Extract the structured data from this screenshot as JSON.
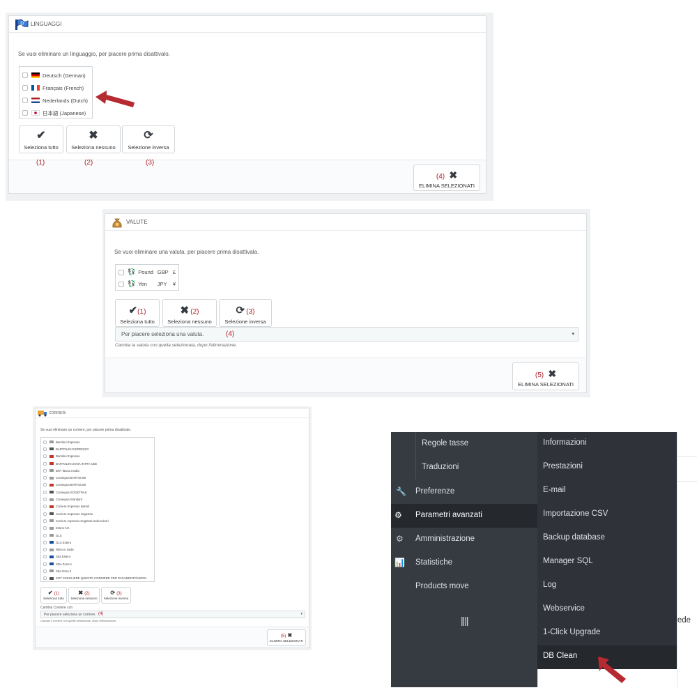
{
  "languages": {
    "title": "LINGUAGGI",
    "intro": "Se vuoi eliminare un linguaggio, per piacere prima disattivalo.",
    "items": [
      {
        "label": "Deutsch (German)",
        "flag": "de"
      },
      {
        "label": "Français (French)",
        "flag": "fr"
      },
      {
        "label": "Nederlands (Dutch)",
        "flag": "nl"
      },
      {
        "label": "日本語 (Japanese)",
        "flag": "jp"
      }
    ],
    "buttons": [
      {
        "label": "Seleziona tutto",
        "icon": "check-icon",
        "num": "(1)"
      },
      {
        "label": "Seleziona nessuno",
        "icon": "cross-icon",
        "num": "(2)"
      },
      {
        "label": "Selezione inversa",
        "icon": "refresh-icon",
        "num": "(3)"
      }
    ],
    "delete": {
      "label": "ELIMINA SELEZIONATI",
      "num": "(4)"
    }
  },
  "currencies": {
    "title": "VALUTE",
    "intro": "Se vuoi eliminare una valuta, per piacere prima disattivala.",
    "items": [
      {
        "name": "Pound",
        "code": "GBP",
        "symbol": "£"
      },
      {
        "name": "Yen",
        "code": "JPY",
        "symbol": "¥"
      }
    ],
    "buttons": [
      {
        "label": "Seleziona tutto",
        "num": "(1)"
      },
      {
        "label": "Seleziona nessuno",
        "num": "(2)"
      },
      {
        "label": "Selezione inversa",
        "num": "(3)"
      }
    ],
    "select_value": "Per piacere seleziona una valuta.",
    "select_num": "(4)",
    "hint": "Cambia la valuta con quella selezionata, dopo l'eliminazione.",
    "delete": {
      "label": "ELIMINA SELEZIONATI",
      "num": "(5)"
    }
  },
  "carriers": {
    "title": "CORRIERI",
    "intro": "Se vuoi eliminare un corriere, per piacere prima disattivalo.",
    "items": [
      "Bartolini Espresso",
      "BARTOLINI ESPRESSO",
      "Bartolini Espresso",
      "BARTOLINI ZONA INTRA CEE",
      "BRT fascia media",
      "Consegna BARTOLINI",
      "Consegna BARTOLINI",
      "Consegna SOGETRAS",
      "Consegna Standard",
      "Corriere Espresso Bartoli",
      "Corriere Espresso Sogetras",
      "Corriere espresso Sogetras Isola minori",
      "Estero NA",
      "GLS",
      "GLS Estero",
      "Ritiro in Sede",
      "Sda Estero",
      "SDA Zona 1",
      "Sda Zona 2",
      "SOT SCEGLIERE QUESTO CORRIERE PER PAGAMENTO/VERSI"
    ],
    "buttons": [
      {
        "label": "Seleziona tutto",
        "num": "(1)"
      },
      {
        "label": "Seleziona nessuno",
        "num": "(2)"
      },
      {
        "label": "Selezione inversa",
        "num": "(3)"
      }
    ],
    "select_label": "Cambia Corriere con",
    "select_value": "Per piacere seleziona un corriere.",
    "select_num": "(4)",
    "hint": "Cambia il corriere con quello selezionato, dopo l'eliminazione.",
    "delete": {
      "label": "ELIMINA SELEZIONATI",
      "num": "(5)"
    }
  },
  "menu": {
    "left": [
      {
        "label": "Regole tasse",
        "icon": ""
      },
      {
        "label": "Traduzioni",
        "icon": ""
      },
      {
        "label": "Preferenze",
        "icon": "wrench-icon"
      },
      {
        "label": "Parametri avanzati",
        "icon": "cogs-icon"
      },
      {
        "label": "Amministrazione",
        "icon": "gear-icon"
      },
      {
        "label": "Statistiche",
        "icon": "bar-chart-icon"
      },
      {
        "label": "Products move",
        "icon": ""
      }
    ],
    "right": [
      "Informazioni",
      "Prestazioni",
      "E-mail",
      "Importazione CSV",
      "Backup database",
      "Manager SQL",
      "Log",
      "Webservice",
      "1-Click Upgrade",
      "DB Clean"
    ],
    "collapse_icon": "collapse-bars-icon",
    "cut_text": "rede"
  },
  "colors": {
    "accent_red": "#b0202a",
    "menu_dark": "#363a41",
    "menu_active": "#25282d"
  }
}
